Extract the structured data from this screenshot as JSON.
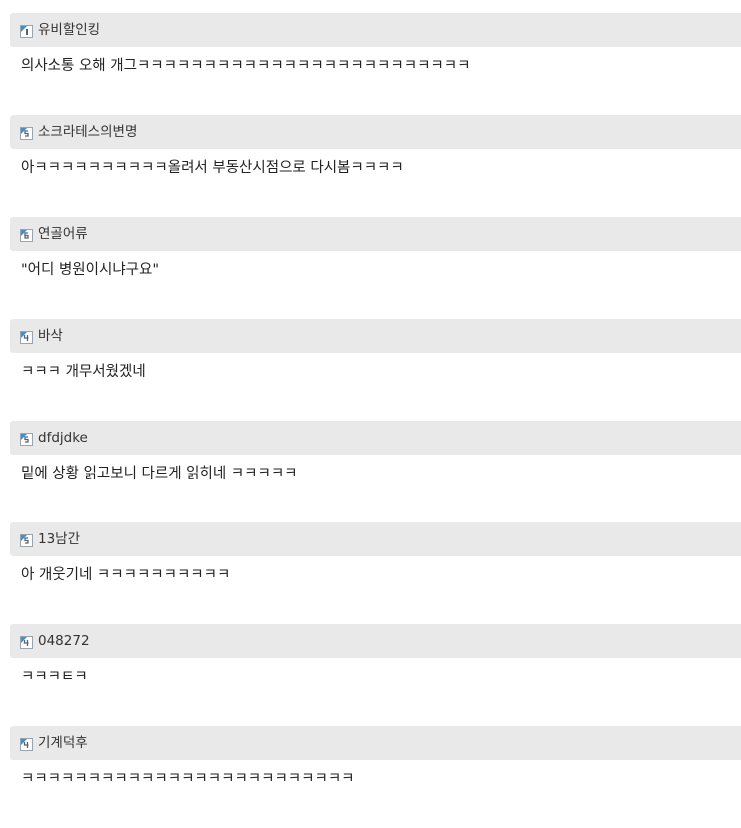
{
  "comments": [
    {
      "nickname": "유비할인킹",
      "text": "의사소통 오해 개그ㅋㅋㅋㅋㅋㅋㅋㅋㅋㅋㅋㅋㅋㅋㅋㅋㅋㅋㅋㅋㅋㅋㅋㅋㅋ",
      "icon": "user-badge-icon"
    },
    {
      "nickname": "소크라테스의변명",
      "text": "아ㅋㅋㅋㅋㅋㅋㅋㅋㅋㅋ올려서 부동산시점으로 다시봄ㅋㅋㅋㅋ",
      "icon": "user-badge-icon"
    },
    {
      "nickname": "연골어류",
      "text": "\"어디 병원이시냐구요\"",
      "icon": "user-badge-icon"
    },
    {
      "nickname": "바삭",
      "text": "ㅋㅋㅋ 개무서웠겠네",
      "icon": "user-badge-icon"
    },
    {
      "nickname": "dfdjdke",
      "text": "밑에 상황 읽고보니 다르게 읽히네 ㅋㅋㅋㅋㅋ",
      "icon": "user-badge-icon"
    },
    {
      "nickname": "13남간",
      "text": "아 개웃기네 ㅋㅋㅋㅋㅋㅋㅋㅋㅋㅋ",
      "icon": "user-badge-icon"
    },
    {
      "nickname": "048272",
      "text": "ㅋㅋㅋㅌㅋ",
      "icon": "user-badge-icon"
    },
    {
      "nickname": "기계덕후",
      "text": "ㅋㅋㅋㅋㅋㅋㅋㅋㅋㅋㅋㅋㅋㅋㅋㅋㅋㅋㅋㅋㅋㅋㅋㅋㅋ",
      "icon": "user-badge-icon"
    }
  ],
  "colors": {
    "header_bg": "#e9e9e9",
    "text": "#222222",
    "nickname": "#333333",
    "icon_accent": "#3f8fd2"
  }
}
